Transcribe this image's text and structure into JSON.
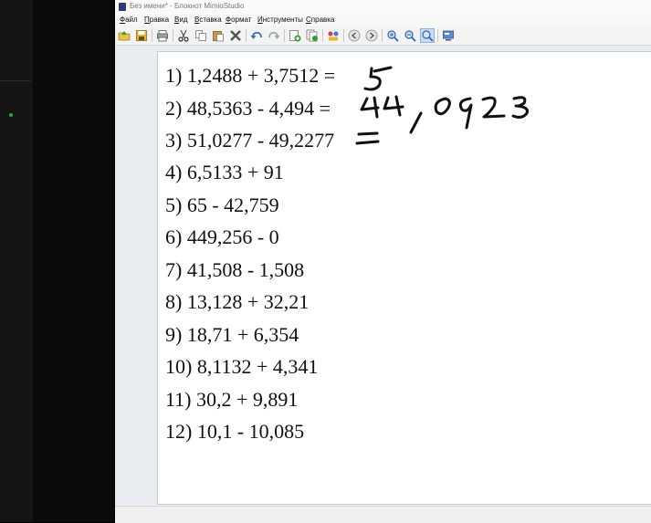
{
  "window": {
    "title": "Без имени* - Блокнот MimioStudio"
  },
  "menu": [
    "Файл",
    "Правка",
    "Вид",
    "Вставка",
    "Формат",
    "Инструменты",
    "Справка"
  ],
  "toolbar": {
    "icons": [
      "open-icon",
      "save-icon",
      "print-icon",
      "cut-icon",
      "copy-icon",
      "paste-icon",
      "delete-icon",
      "undo-icon",
      "redo-icon",
      "new-page-icon",
      "duplicate-page-icon",
      "gallery-icon",
      "back-icon",
      "forward-icon",
      "zoom-in-icon",
      "zoom-out-icon",
      "zoom-fit-icon",
      "display-icon"
    ],
    "active": "zoom-fit-icon"
  },
  "notebook": {
    "lines": [
      "1) 1,2488 + 3,7512 =",
      "2) 48,5363 - 4,494 =",
      "3) 51,0277 - 49,2277",
      "4) 6,5133 + 91",
      "5) 65 - 42,759",
      "6) 449,256 - 0",
      "7) 41,508 - 1,508",
      "8) 13,128 + 32,21",
      "9) 18,71 + 6,354",
      "10) 8,1132 + 4,341",
      "11) 30,2 + 9,891",
      "12) 10,1 - 10,085"
    ],
    "handwritten": [
      "5",
      "44,0923",
      "="
    ]
  }
}
